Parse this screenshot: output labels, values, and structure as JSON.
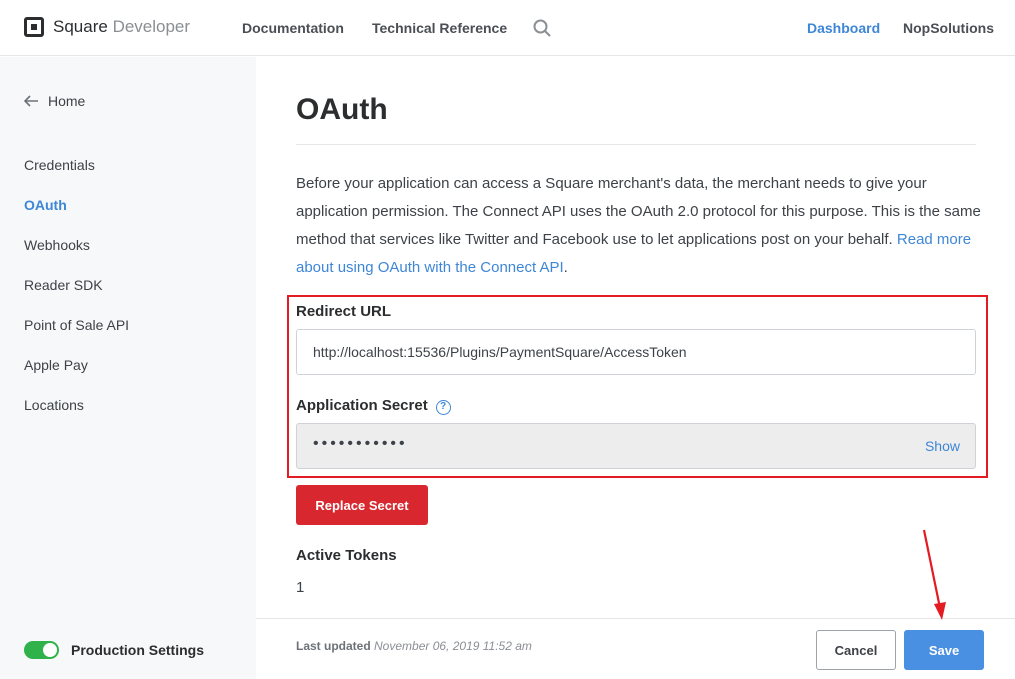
{
  "header": {
    "brand": "Square",
    "brand_suffix": "Developer",
    "nav": [
      "Documentation",
      "Technical Reference"
    ],
    "dashboard": "Dashboard",
    "account": "NopSolutions"
  },
  "sidebar": {
    "home": "Home",
    "items": [
      {
        "label": "Credentials",
        "active": false
      },
      {
        "label": "OAuth",
        "active": true
      },
      {
        "label": "Webhooks",
        "active": false
      },
      {
        "label": "Reader SDK",
        "active": false
      },
      {
        "label": "Point of Sale API",
        "active": false
      },
      {
        "label": "Apple Pay",
        "active": false
      },
      {
        "label": "Locations",
        "active": false
      }
    ],
    "toggle_label": "Production Settings",
    "toggle_on": true
  },
  "main": {
    "title": "OAuth",
    "description": "Before your application can access a Square merchant's data, the merchant needs to give your application permission. The Connect API uses the OAuth 2.0 protocol for this purpose. This is the same method that services like Twitter and Facebook use to let applications post on your behalf. ",
    "description_link": "Read more about using OAuth with the Connect API",
    "redirect_label": "Redirect URL",
    "redirect_value": "http://localhost:15536/Plugins/PaymentSquare/AccessToken",
    "secret_label": "Application Secret",
    "secret_masked": "•••••••••••",
    "show_label": "Show",
    "replace_label": "Replace Secret",
    "tokens_label": "Active Tokens",
    "tokens_value": "1"
  },
  "footer": {
    "updated_label": "Last updated",
    "updated_value": "November 06, 2019 11:52 am",
    "cancel": "Cancel",
    "save": "Save"
  },
  "colors": {
    "accent": "#3e86d6",
    "danger": "#d8272e",
    "highlight": "#e31b23",
    "toggle": "#2fb24a"
  }
}
